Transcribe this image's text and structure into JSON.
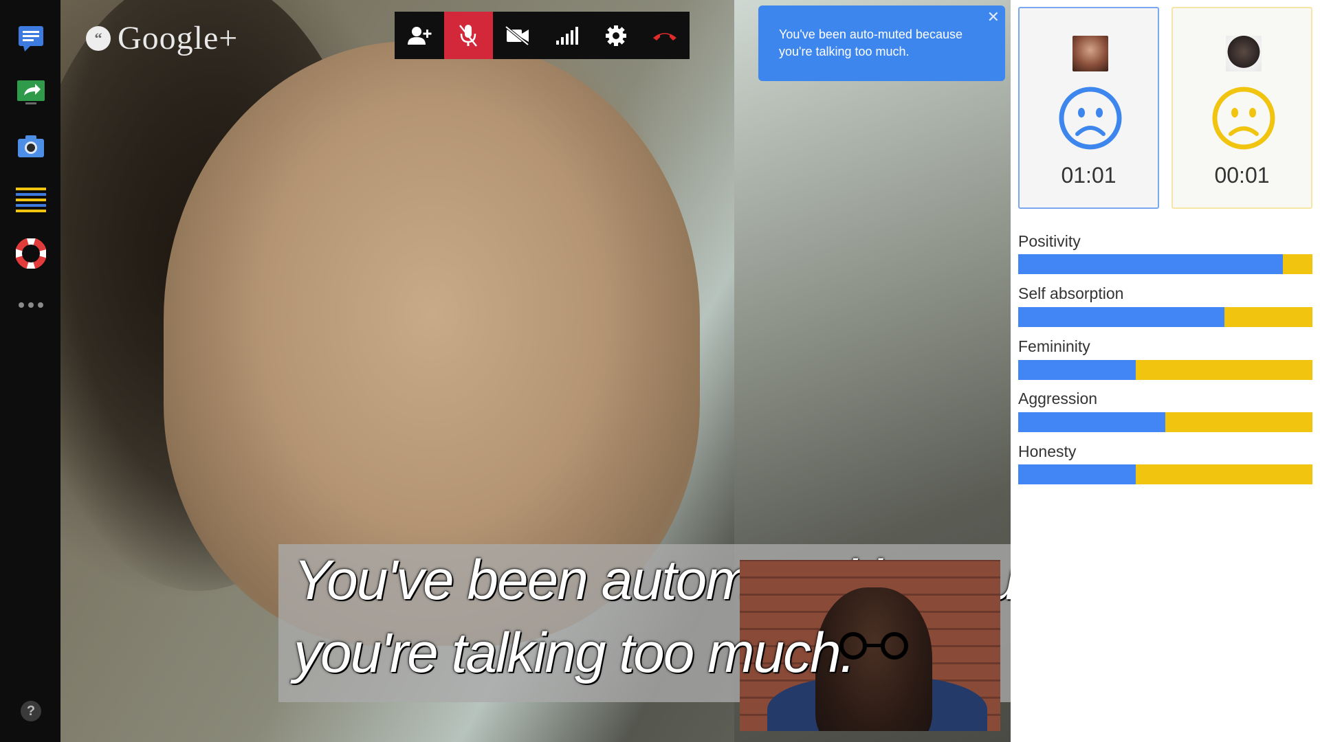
{
  "app": {
    "logo_text": "Google+"
  },
  "sidebar": {
    "items": [
      {
        "name": "chat-icon"
      },
      {
        "name": "screenshare-icon"
      },
      {
        "name": "camera-icon"
      },
      {
        "name": "list-icon"
      },
      {
        "name": "help-ring-icon"
      },
      {
        "name": "more-icon"
      }
    ],
    "help_label": "?"
  },
  "toolbar": {
    "buttons": [
      {
        "name": "invite-button",
        "icon": "add-person-icon",
        "active": false
      },
      {
        "name": "mute-button",
        "icon": "mic-off-icon",
        "active": true
      },
      {
        "name": "camera-button",
        "icon": "video-off-icon",
        "active": false
      },
      {
        "name": "bandwidth-button",
        "icon": "signal-bars-icon",
        "active": false
      },
      {
        "name": "settings-button",
        "icon": "gear-icon",
        "active": false
      },
      {
        "name": "hangup-button",
        "icon": "phone-hangup-icon",
        "active": false
      }
    ]
  },
  "notification": {
    "text": "You've been auto-muted because you're talking too much.",
    "close_label": "✕"
  },
  "subtitle": {
    "line1": "You've been automuted because",
    "line2": "you're talking too much."
  },
  "participants": [
    {
      "time": "01:01",
      "mood": "sad",
      "color": "#3d86ee"
    },
    {
      "time": "00:01",
      "mood": "sad",
      "color": "#f1c40f"
    }
  ],
  "metrics": [
    {
      "label": "Positivity",
      "value": 0.9
    },
    {
      "label": "Self absorption",
      "value": 0.7
    },
    {
      "label": "Femininity",
      "value": 0.4
    },
    {
      "label": "Aggression",
      "value": 0.5
    },
    {
      "label": "Honesty",
      "value": 0.4
    }
  ],
  "colors": {
    "blue": "#4285f4",
    "yellow": "#f1c40f",
    "mute_red": "#d2283a"
  }
}
